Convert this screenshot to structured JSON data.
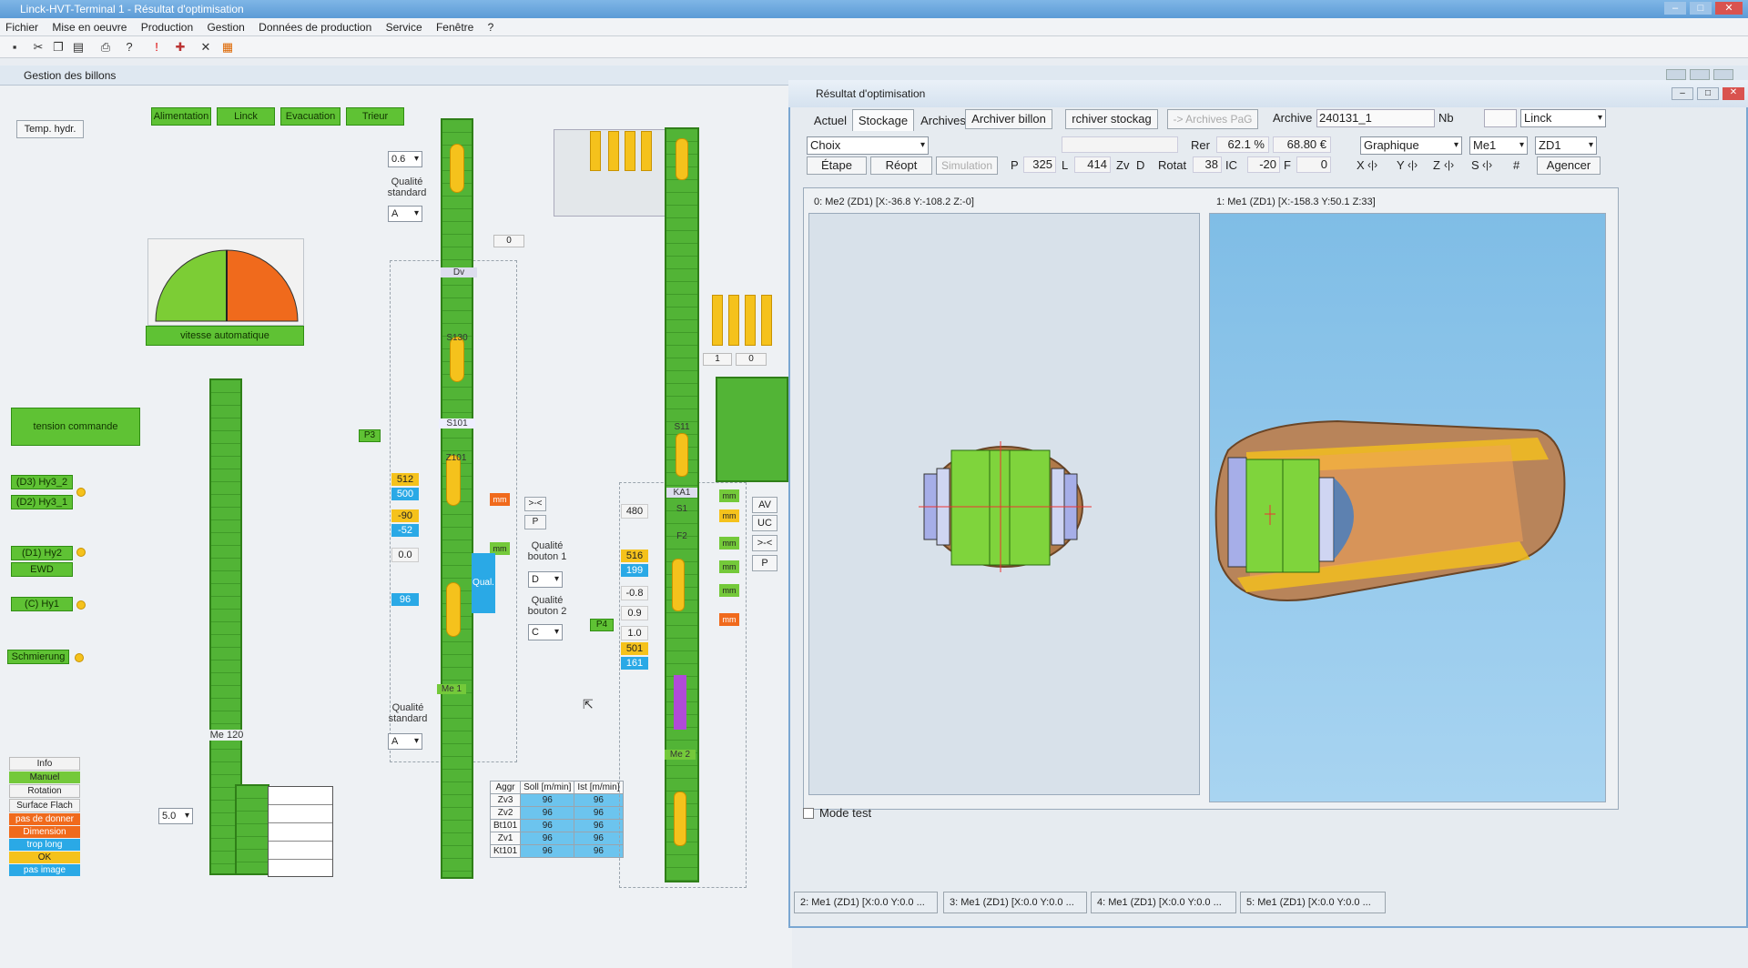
{
  "window": {
    "title": "Linck-HVT-Terminal 1 - Résultat d'optimisation"
  },
  "menu": [
    "Fichier",
    "Mise en oeuvre",
    "Production",
    "Gestion",
    "Données de production",
    "Service",
    "Fenêtre",
    "?"
  ],
  "subwindow": {
    "title": "Gestion des billons"
  },
  "left": {
    "temp_hydr": "Temp. hydr.",
    "top_buttons": [
      "Alimentation",
      "Linck",
      "Evacuation",
      "Trieur"
    ],
    "gauge_label": "vitesse automatique",
    "tension_label": "tension commande",
    "status_items": [
      "(D3) Hy3_2",
      "(D2) Hy3_1",
      "(D1) Hy2",
      "EWD",
      "(C) Hy1",
      "Schmierung"
    ],
    "legend": [
      {
        "label": "Info",
        "color": "#f3f3f3"
      },
      {
        "label": "Manuel",
        "color": "#74c93a"
      },
      {
        "label": "Rotation",
        "color": "#f3f3f3"
      },
      {
        "label": "Surface Flach",
        "color": "#f3f3f3"
      },
      {
        "label": "pas de donner",
        "color": "#f06a1c"
      },
      {
        "label": "Dimension",
        "color": "#f06a1c"
      },
      {
        "label": "trop long",
        "color": "#2aa9e6"
      },
      {
        "label": "OK",
        "color": "#f5c21c"
      },
      {
        "label": "pas image",
        "color": "#2aa9e6"
      }
    ],
    "me120": "Me 120",
    "speed_select": "5.0"
  },
  "line1": {
    "speed_select": "0.6",
    "qual_std_label": "Qualité standard",
    "qual_std_value": "A",
    "counter": "0",
    "labels": {
      "dv": "Dv",
      "s130": "S130",
      "s101": "S101",
      "z101": "Z101",
      "p3": "P3",
      "me1": "Me 1"
    },
    "values": [
      "512",
      "500",
      "-90",
      "-52",
      "0.0",
      "96"
    ],
    "mm": "mm",
    "qual": "Qual.",
    "qual_std2_label": "Qualité standard",
    "qual_std2_value": "A"
  },
  "mid": {
    "btn_merge": ">-<",
    "btn_p": "P",
    "qb1_label": "Qualité bouton 1",
    "qb1_value": "D",
    "qb2_label": "Qualité bouton 2",
    "qb2_value": "C",
    "p4": "P4",
    "ycaps_label": "A"
  },
  "aggr": {
    "headers": [
      "Aggr",
      "Soll [m/min]",
      "Ist [m/min]"
    ],
    "rows": [
      [
        "Zv3",
        "96",
        "96"
      ],
      [
        "Zv2",
        "96",
        "96"
      ],
      [
        "Bt101",
        "96",
        "96"
      ],
      [
        "Zv1",
        "96",
        "96"
      ],
      [
        "Kt101",
        "96",
        "96"
      ]
    ]
  },
  "line2": {
    "labels": {
      "s11": "S11",
      "ka1": "KA1",
      "s1": "S1",
      "f2": "F2",
      "me2": "Me 2"
    },
    "values": [
      "480",
      "516",
      "199",
      "-0.8",
      "0.9",
      "1.0",
      "501",
      "161"
    ],
    "mm": "mm",
    "side_buttons": [
      "AV",
      "UC",
      ">-<",
      "P"
    ],
    "counters": [
      "1",
      "0"
    ]
  },
  "opt": {
    "title": "Résultat d'optimisation",
    "tabs": [
      "Actuel",
      "Stockage",
      "Archives"
    ],
    "archiver_billon": "Archiver billon",
    "archiver_stockage": "rchiver stockag",
    "archives_pag": "-> Archives PaG",
    "archive_label": "Archive",
    "archive_value": "240131_1",
    "nb_label": "Nb",
    "nb_value": "",
    "linck_select": "Linck",
    "choix_select": "Choix",
    "rer_label": "Rer",
    "rer_value": "62.1 %",
    "price": "68.80 €",
    "graphique_select": "Graphique",
    "me_select": "Me1",
    "zd_select": "ZD1",
    "etape": "Étape",
    "reopt": "Réopt",
    "simulation": "Simulation",
    "p_label": "P",
    "p_value": "325",
    "l_label": "L",
    "l_value": "414",
    "zv_label": "Zv",
    "zv_value": "D",
    "rotat_label": "Rotat",
    "rotat_value": "38",
    "ic_label": "IC",
    "ic_value": "-20",
    "f_label": "F",
    "f_value": "0",
    "axes": [
      "X",
      "Y",
      "Z",
      "S",
      "#"
    ],
    "agencer": "Agencer",
    "view0_title": "0:  Me2 (ZD1) [X:-36.8 Y:-108.2 Z:-0]",
    "view1_title": "1:  Me1 (ZD1) [X:-158.3 Y:50.1 Z:33]",
    "mode_test": "Mode test",
    "bottom_tabs": [
      "2:  Me1 (ZD1) [X:0.0 Y:0.0 ...",
      "3:  Me1 (ZD1) [X:0.0 Y:0.0 ...",
      "4:  Me1 (ZD1) [X:0.0 Y:0.0 ...",
      "5:  Me1 (ZD1) [X:0.0 Y:0.0 ..."
    ]
  }
}
